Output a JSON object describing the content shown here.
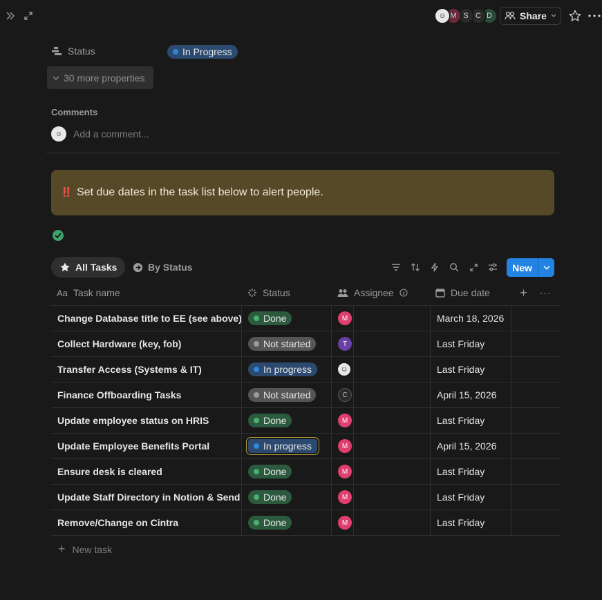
{
  "topbar": {
    "avatars": [
      "",
      "M",
      "S",
      "C",
      "D"
    ],
    "share_label": "Share"
  },
  "properties": {
    "status_label": "Status",
    "status_value": "In Progress",
    "more_label": "30 more properties"
  },
  "comments": {
    "title": "Comments",
    "placeholder": "Add a comment..."
  },
  "callout": {
    "icon": "‼",
    "text": "Set due dates in the task list below to alert people."
  },
  "views": {
    "active_tab": "All Tasks",
    "other_tab": "By Status",
    "new_label": "New"
  },
  "table": {
    "headers": {
      "name": "Task name",
      "status": "Status",
      "assignee": "Assignee",
      "due": "Due date"
    },
    "rows": [
      {
        "name": "Change Database title to EE (see above)",
        "status": "Done",
        "assignee": "M",
        "due": "March 18, 2026"
      },
      {
        "name": "Collect Hardware (key, fob)",
        "status": "Not started",
        "assignee": "T",
        "due": "Last Friday"
      },
      {
        "name": "Transfer Access (Systems & IT)",
        "status": "In progress",
        "assignee": "",
        "due": "Last Friday"
      },
      {
        "name": "Finance Offboarding Tasks",
        "status": "Not started",
        "assignee": "C",
        "due": "April 15, 2026"
      },
      {
        "name": "Update employee status on HRIS",
        "status": "Done",
        "assignee": "M",
        "due": "Last Friday"
      },
      {
        "name": "Update Employee Benefits Portal",
        "status": "In progress",
        "assignee": "M",
        "due": "April 15, 2026"
      },
      {
        "name": "Ensure desk is cleared",
        "status": "Done",
        "assignee": "M",
        "due": "Last Friday"
      },
      {
        "name": "Update Staff Directory in Notion & Send",
        "status": "Done",
        "assignee": "M",
        "due": "Last Friday"
      },
      {
        "name": "Remove/Change on Cintra",
        "status": "Done",
        "assignee": "M",
        "due": "Last Friday"
      }
    ],
    "new_task_label": "New task"
  },
  "colors": {
    "background": "#191919",
    "accent": "#2383e2",
    "done": "#2b5a3e",
    "in_progress": "#2c4a70",
    "not_started": "#555555",
    "callout": "#564928"
  }
}
